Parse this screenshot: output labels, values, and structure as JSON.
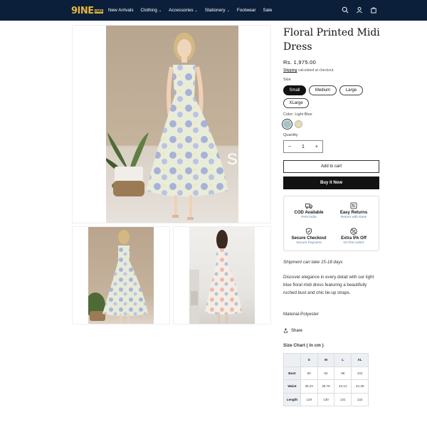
{
  "header": {
    "logo_text": "9INE",
    "logo_tag": "OVER",
    "nav": [
      {
        "label": "New Arrivals",
        "dropdown": false
      },
      {
        "label": "Clothing",
        "dropdown": true
      },
      {
        "label": "Accessories",
        "dropdown": true
      },
      {
        "label": "Stationery",
        "dropdown": true
      },
      {
        "label": "Footwear",
        "dropdown": false
      },
      {
        "label": "Sale",
        "dropdown": false
      }
    ],
    "icons": [
      "search-icon",
      "account-icon",
      "cart-icon"
    ]
  },
  "gallery": {
    "overlay_letter": "S"
  },
  "product": {
    "title": "Floral Printed Midi Dress",
    "price": "Rs. 1,975.00",
    "shipping_link": "Shipping",
    "shipping_text": " calculated at checkout.",
    "size_label": "Size",
    "sizes": [
      "Small",
      "Medium",
      "Large",
      "XLarge"
    ],
    "selected_size": "Small",
    "color_label": "Color: Light Blue",
    "colors": [
      "#a7c2c4",
      "#e8dcae"
    ],
    "quantity_label": "Quantity",
    "quantity": "1",
    "qty_minus": "−",
    "qty_plus": "+",
    "add_to_cart": "Add to cart",
    "buy_now": "Buy it Now",
    "features": [
      {
        "title": "COD Available",
        "sub": "PAN India",
        "icon": "truck-icon"
      },
      {
        "title": "Easy Returns",
        "sub": "Return with Ease",
        "icon": "return-box-icon"
      },
      {
        "title": "Secure Checkout",
        "sub": "Secure Payment",
        "icon": "shield-icon"
      },
      {
        "title": "Extra 5% Off",
        "sub": "On first order!",
        "icon": "percent-icon"
      }
    ],
    "shipment_note": "Shipment can take 15-18 days",
    "description": "Discover elegance in every detail with our light blue floral midi dress featuring a beautifully ruched bust and chic tie-up straps.",
    "material": "Material-Polyester",
    "share": "Share",
    "size_chart_title": "Size Chart ( in cm )",
    "size_chart": {
      "headers": [
        "",
        "S",
        "M",
        "L",
        "XL"
      ],
      "rows": [
        [
          "Bust",
          "90",
          "94",
          "98",
          "102"
        ],
        [
          "Waist",
          "36.22",
          "39.78",
          "43.12",
          "44.48"
        ],
        [
          "Length",
          "129",
          "130",
          "131",
          "132"
        ]
      ]
    }
  }
}
